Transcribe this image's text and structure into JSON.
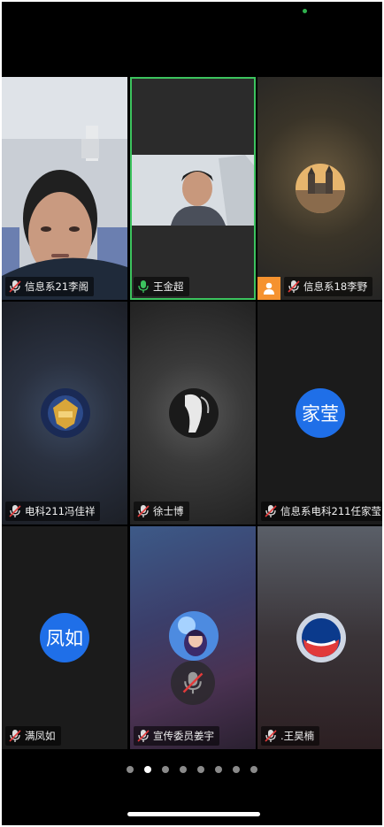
{
  "participants": [
    {
      "name": "信息系21李阁",
      "mic": "muted",
      "kind": "camera"
    },
    {
      "name": "王金超",
      "mic": "active",
      "kind": "camera-speaking"
    },
    {
      "name": "信息系18李野",
      "mic": "muted",
      "kind": "avatar-image",
      "avatar_icon": "castle-photo-icon"
    },
    {
      "name": "电科211冯佳祥",
      "mic": "muted",
      "kind": "avatar-image",
      "avatar_icon": "game-emblem-icon"
    },
    {
      "name": "徐士博",
      "mic": "muted",
      "kind": "avatar-image",
      "avatar_icon": "dark-figure-icon"
    },
    {
      "name": "信息系电科211任家莹",
      "mic": "muted",
      "kind": "avatar-text",
      "avatar_text": "家莹"
    },
    {
      "name": "满凤如",
      "mic": "muted",
      "kind": "avatar-text",
      "avatar_text": "凤如"
    },
    {
      "name": "宣传委员姜宇",
      "mic": "muted",
      "kind": "avatar-image",
      "avatar_icon": "anime-character-icon"
    },
    {
      "name": ".王昊楠",
      "mic": "muted",
      "kind": "avatar-image",
      "avatar_icon": "pepsi-logo-icon"
    }
  ],
  "pager": {
    "total": 8,
    "active_index": 1
  },
  "colors": {
    "speaker_border": "#3cc35e",
    "avatar_text_bg": "#1f6fe8",
    "person_badge": "#f5922f",
    "mute_red": "#e23a3a"
  }
}
